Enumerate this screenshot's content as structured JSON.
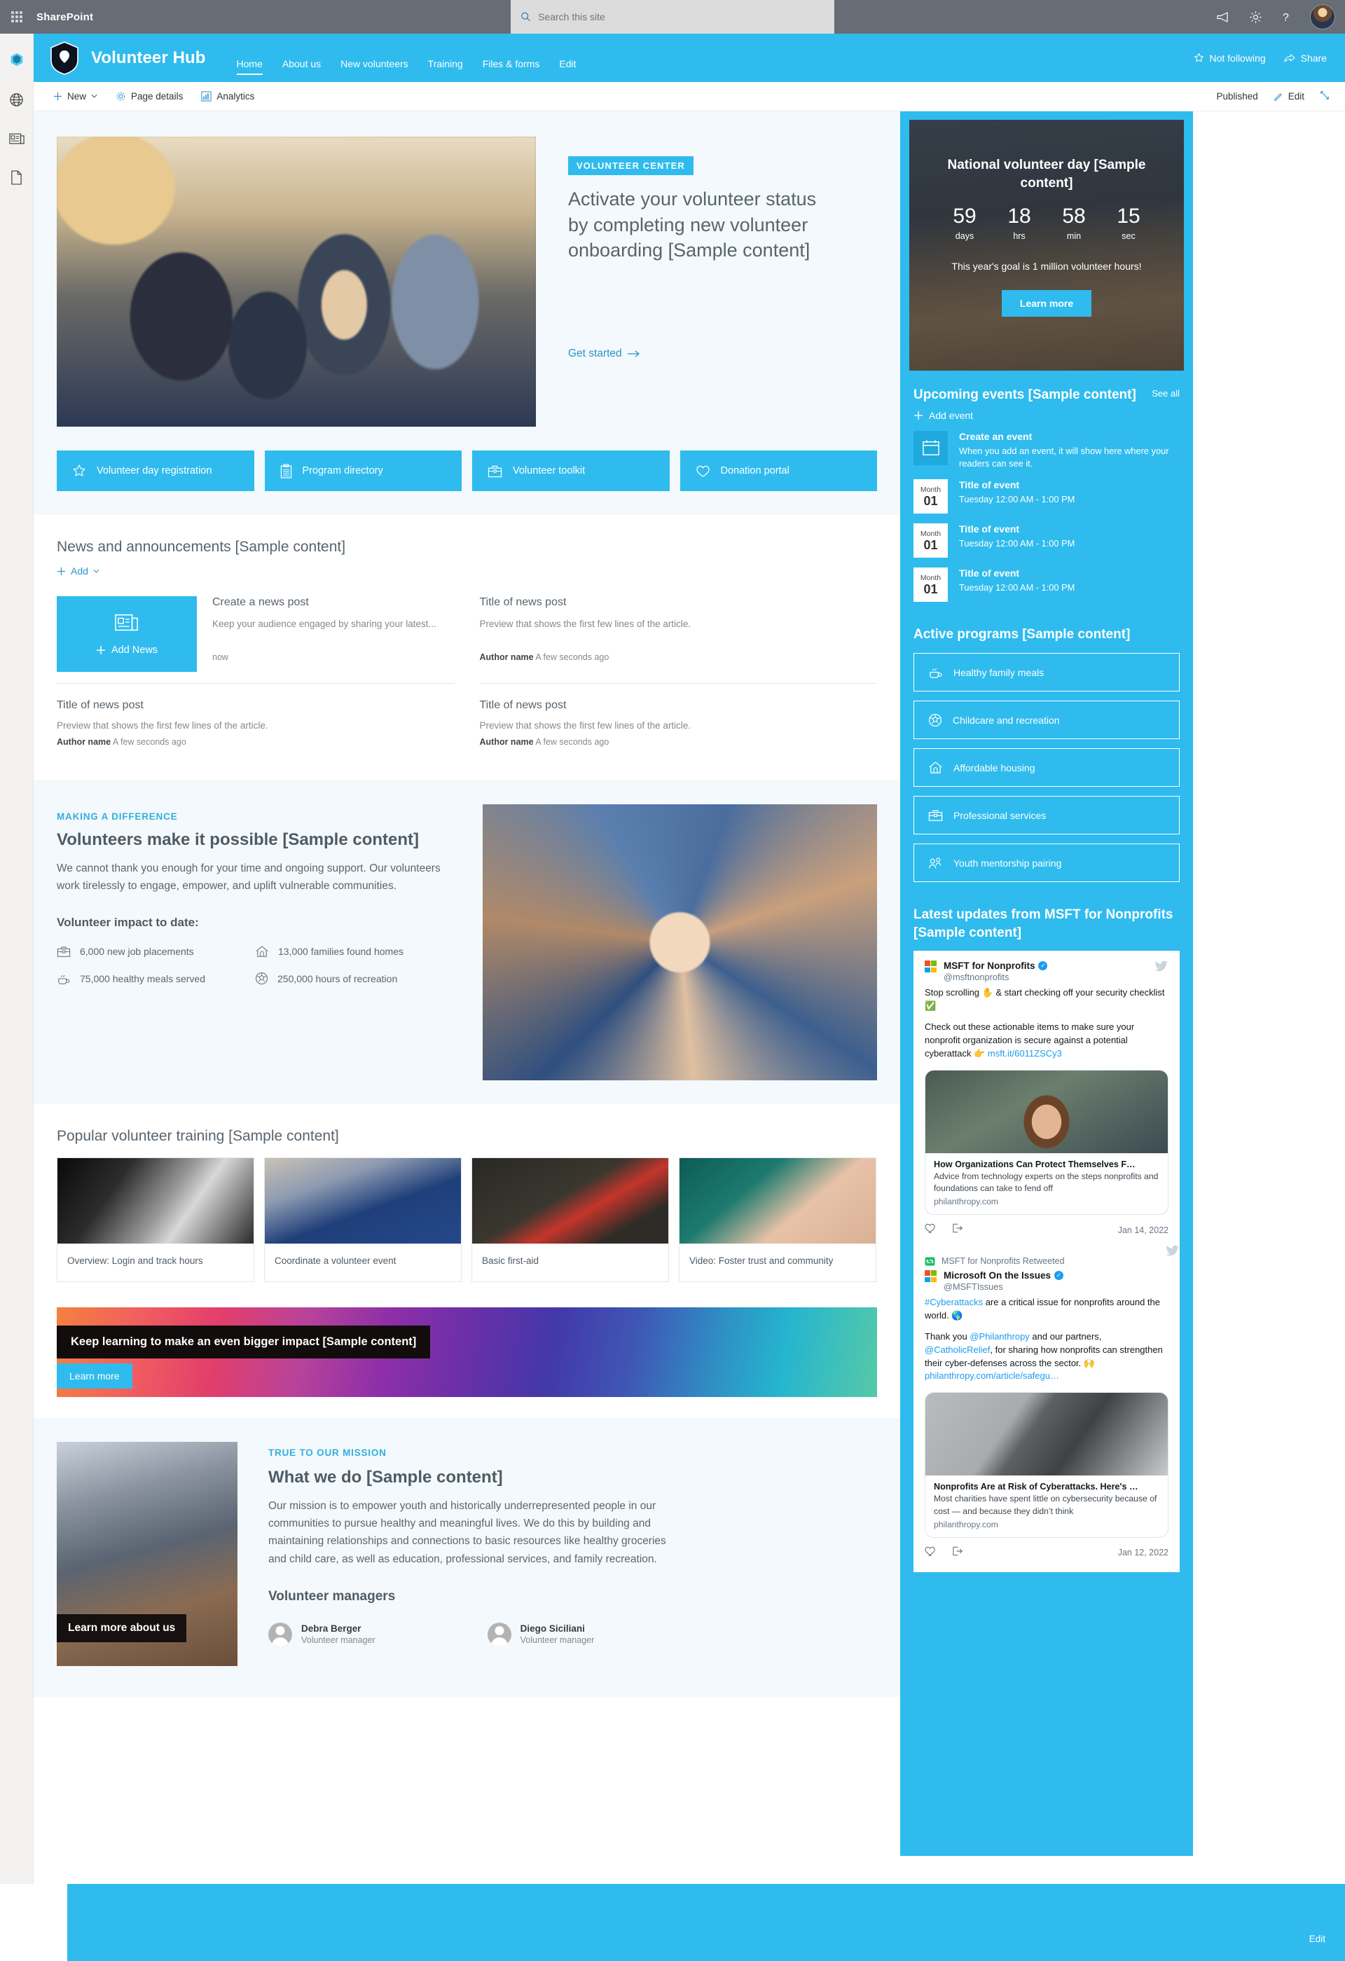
{
  "suite": {
    "brand": "SharePoint",
    "search_placeholder": "Search this site",
    "icons": [
      "waffle-icon",
      "megaphone-icon",
      "gear-icon",
      "help-icon",
      "avatar"
    ]
  },
  "rail": {
    "items": [
      {
        "name": "sharepoint-home-icon",
        "label": "SharePoint"
      },
      {
        "name": "globe-icon",
        "label": "Sites"
      },
      {
        "name": "news-icon",
        "label": "News"
      },
      {
        "name": "file-icon",
        "label": "Files"
      }
    ]
  },
  "site": {
    "title": "Volunteer Hub",
    "nav": [
      {
        "label": "Home",
        "selected": true
      },
      {
        "label": "About us",
        "selected": false
      },
      {
        "label": "New volunteers",
        "selected": false
      },
      {
        "label": "Training",
        "selected": false
      },
      {
        "label": "Files & forms",
        "selected": false
      },
      {
        "label": "Edit",
        "selected": false
      }
    ],
    "follow_label": "Not following",
    "share_label": "Share"
  },
  "commandbar": {
    "new_label": "New",
    "page_details_label": "Page details",
    "analytics_label": "Analytics",
    "status_label": "Published",
    "edit_label": "Edit"
  },
  "hero": {
    "eyebrow": "VOLUNTEER CENTER",
    "heading": "Activate your volunteer status by completing new volunteer onboarding [Sample content]",
    "cta": "Get started"
  },
  "quicklinks": [
    {
      "label": "Volunteer day registration",
      "icon": "star-icon"
    },
    {
      "label": "Program directory",
      "icon": "clipboard-icon"
    },
    {
      "label": "Volunteer toolkit",
      "icon": "toolbox-icon"
    },
    {
      "label": "Donation portal",
      "icon": "heart-icon"
    }
  ],
  "news": {
    "heading": "News and announcements [Sample content]",
    "add_label": "Add",
    "add_news_label": "Add News",
    "featured": {
      "title": "Create a news post",
      "preview": "Keep your audience engaged by sharing your latest...",
      "time": "now"
    },
    "posts": [
      {
        "title": "Title of news post",
        "preview": "Preview that shows the first few lines of the article.",
        "author": "Author name",
        "time": "A few seconds ago"
      },
      {
        "title": "Title of news post",
        "preview": "Preview that shows the first few lines of the article.",
        "author": "Author name",
        "time": "A few seconds ago"
      },
      {
        "title": "Title of news post",
        "preview": "Preview that shows the first few lines of the article.",
        "author": "Author name",
        "time": "A few seconds ago"
      }
    ]
  },
  "difference": {
    "kicker": "MAKING A DIFFERENCE",
    "heading": "Volunteers make it possible [Sample content]",
    "body": "We cannot thank you enough for your time and ongoing support. Our volunteers work tirelessly to engage, empower, and uplift vulnerable communities.",
    "impact_label": "Volunteer impact to date:",
    "stats": [
      {
        "icon": "briefcase-icon",
        "text": "6,000 new job placements"
      },
      {
        "icon": "home-icon",
        "text": "13,000 families found homes"
      },
      {
        "icon": "meal-icon",
        "text": "75,000 healthy meals served"
      },
      {
        "icon": "ball-icon",
        "text": "250,000 hours of recreation"
      }
    ]
  },
  "training": {
    "heading": "Popular volunteer training [Sample content]",
    "cards": [
      {
        "caption": "Overview: Login and track hours"
      },
      {
        "caption": "Coordinate a volunteer event"
      },
      {
        "caption": "Basic first-aid"
      },
      {
        "caption": "Video: Foster trust and community"
      }
    ]
  },
  "banner": {
    "label": "Keep learning to make an even bigger impact [Sample content]",
    "button": "Learn more"
  },
  "whatwedo": {
    "image_caption": "Learn more about us",
    "kicker": "TRUE TO OUR MISSION",
    "heading": "What we do [Sample content]",
    "body": "Our mission is to empower youth and historically underrepresented people in our communities to pursue healthy and meaningful lives. We do this by building and maintaining relationships and connections to basic resources like healthy groceries and child care, as well as education, professional services, and family recreation.",
    "managers_label": "Volunteer managers",
    "managers": [
      {
        "name": "Debra Berger",
        "role": "Volunteer manager"
      },
      {
        "name": "Diego Siciliani",
        "role": "Volunteer manager"
      }
    ]
  },
  "countdown": {
    "title": "National volunteer day [Sample content]",
    "units": [
      {
        "value": "59",
        "unit": "days"
      },
      {
        "value": "18",
        "unit": "hrs"
      },
      {
        "value": "58",
        "unit": "min"
      },
      {
        "value": "15",
        "unit": "sec"
      }
    ],
    "goal": "This year's goal is 1 million volunteer hours!",
    "button": "Learn more"
  },
  "events": {
    "heading": "Upcoming events [Sample content]",
    "see_all": "See all",
    "add_label": "Add event",
    "create": {
      "title": "Create an event",
      "description": "When you add an event, it will show here where your readers can see it."
    },
    "items": [
      {
        "month": "Month",
        "day": "01",
        "title": "Title of event",
        "when": "Tuesday 12:00 AM - 1:00 PM"
      },
      {
        "month": "Month",
        "day": "01",
        "title": "Title of event",
        "when": "Tuesday 12:00 AM - 1:00 PM"
      },
      {
        "month": "Month",
        "day": "01",
        "title": "Title of event",
        "when": "Tuesday 12:00 AM - 1:00 PM"
      }
    ]
  },
  "programs": {
    "heading": "Active programs [Sample content]",
    "items": [
      {
        "label": "Healthy family meals",
        "icon": "meal-icon"
      },
      {
        "label": "Childcare and recreation",
        "icon": "ball-icon"
      },
      {
        "label": "Affordable housing",
        "icon": "home-icon"
      },
      {
        "label": "Professional services",
        "icon": "briefcase-icon"
      },
      {
        "label": "Youth mentorship pairing",
        "icon": "people-icon"
      }
    ]
  },
  "twitter": {
    "heading": "Latest updates from MSFT for Nonprofits [Sample content]",
    "tweets": [
      {
        "account_name": "MSFT for Nonprofits",
        "handle": "@msftnonprofits",
        "verified": true,
        "line1": "Stop scrolling ✋ & start checking off your security checklist ✅",
        "line2": "Check out these actionable items to make sure your nonprofit organization is secure against a potential cyberattack 👉 ",
        "link": "msft.it/6011ZSCy3",
        "preview_title": "How Organizations Can Protect Themselves F…",
        "preview_desc": "Advice from technology experts on the steps nonprofits and foundations can take to fend off",
        "preview_domain": "philanthropy.com",
        "date": "Jan 14, 2022"
      },
      {
        "retweet_label": "MSFT for Nonprofits Retweeted",
        "account_name": "Microsoft On the Issues",
        "handle": "@MSFTIssues",
        "verified": true,
        "line1_a": "#Cyberattacks",
        "line1_b": " are a critical issue for nonprofits around the world. 🌎",
        "line2_a": "Thank you ",
        "line2_mention1": "@Philanthropy",
        "line2_b": " and our partners, ",
        "line2_mention2": "@CatholicRelief",
        "line2_c": ", for sharing how nonprofits can strengthen their cyber-defenses across the sector. 🙌",
        "link": "philanthropy.com/article/safegu…",
        "preview_title": "Nonprofits Are at Risk of Cyberattacks. Here's …",
        "preview_desc": "Most charities have spent little on cybersecurity because of cost — and because they didn’t think",
        "preview_domain": "philanthropy.com",
        "date": "Jan 12, 2022"
      }
    ]
  },
  "footer": {
    "edit_label": "Edit"
  },
  "colors": {
    "accent": "#2fbbee",
    "suitebar": "#666d74",
    "tint": "#f3f9fc",
    "twitter_blue": "#1d9bf0"
  }
}
